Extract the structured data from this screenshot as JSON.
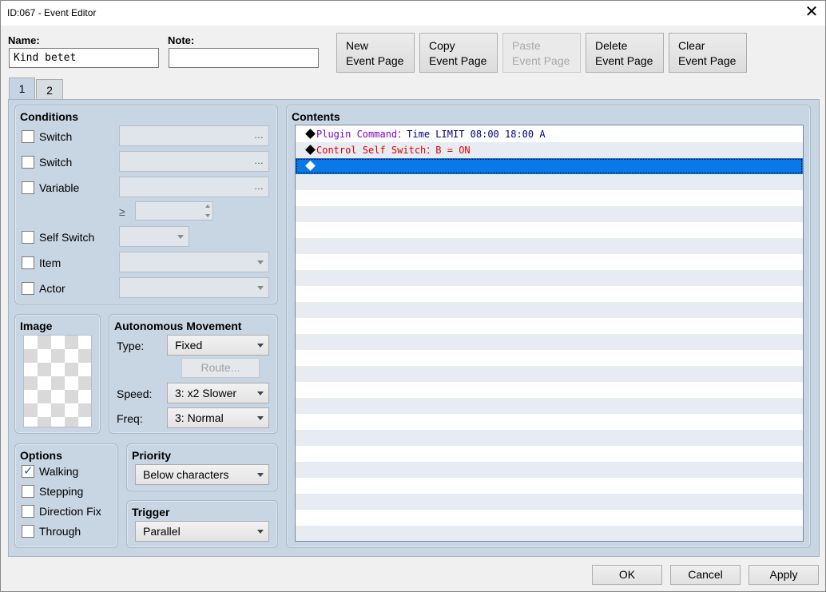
{
  "window": {
    "title": "ID:067 - Event Editor",
    "close_glyph": "✕"
  },
  "header": {
    "name_label": "Name:",
    "name_value": "Kind betet",
    "note_label": "Note:",
    "note_value": "",
    "buttons": [
      {
        "line1": "New",
        "line2": "Event Page",
        "enabled": true
      },
      {
        "line1": "Copy",
        "line2": "Event Page",
        "enabled": true
      },
      {
        "line1": "Paste",
        "line2": "Event Page",
        "enabled": false
      },
      {
        "line1": "Delete",
        "line2": "Event Page",
        "enabled": true
      },
      {
        "line1": "Clear",
        "line2": "Event Page",
        "enabled": true
      }
    ]
  },
  "tabs": [
    {
      "label": "1",
      "active": true
    },
    {
      "label": "2",
      "active": false
    }
  ],
  "conditions": {
    "title": "Conditions",
    "rows": [
      {
        "label": "Switch",
        "checked": false,
        "control": "picker",
        "value": "",
        "icon": "…"
      },
      {
        "label": "Switch",
        "checked": false,
        "control": "picker",
        "value": "",
        "icon": "…"
      },
      {
        "label": "Variable",
        "checked": false,
        "control": "picker",
        "value": "",
        "icon": "…"
      },
      {
        "label": "Self Switch",
        "checked": false,
        "control": "dropdown",
        "value": ""
      },
      {
        "label": "Item",
        "checked": false,
        "control": "dropdown",
        "value": ""
      },
      {
        "label": "Actor",
        "checked": false,
        "control": "dropdown",
        "value": ""
      }
    ],
    "variable_operator": "≥",
    "variable_value": ""
  },
  "image": {
    "title": "Image"
  },
  "autonomous": {
    "title": "Autonomous Movement",
    "type_label": "Type:",
    "type_value": "Fixed",
    "route_label": "Route...",
    "speed_label": "Speed:",
    "speed_value": "3: x2 Slower",
    "freq_label": "Freq:",
    "freq_value": "3: Normal"
  },
  "options": {
    "title": "Options",
    "items": [
      {
        "label": "Walking",
        "checked": true
      },
      {
        "label": "Stepping",
        "checked": false
      },
      {
        "label": "Direction Fix",
        "checked": false
      },
      {
        "label": "Through",
        "checked": false
      }
    ]
  },
  "priority": {
    "title": "Priority",
    "value": "Below characters"
  },
  "trigger": {
    "title": "Trigger",
    "value": "Parallel"
  },
  "contents": {
    "title": "Contents",
    "commands": [
      {
        "prefix": "Plugin Command",
        "sep": "：",
        "text": "Time LIMIT 08:00 18:00 A",
        "prefix_color": "#8000c0",
        "text_color": "#000080"
      },
      {
        "prefix": "Control Self Switch",
        "sep": "：",
        "text": "B = ON",
        "prefix_color": "#e00000",
        "text_color": "#e00000"
      },
      {
        "prefix": "",
        "sep": "",
        "text": "",
        "selected": true
      }
    ],
    "total_rows": 26
  },
  "footer": {
    "ok": "OK",
    "cancel": "Cancel",
    "apply": "Apply"
  },
  "colors": {
    "panel": "#c8d5e3",
    "selection": "#0a78e6"
  }
}
